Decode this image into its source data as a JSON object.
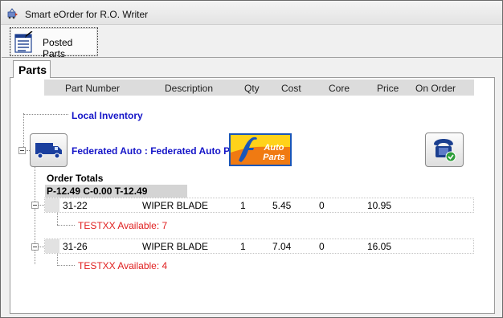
{
  "window": {
    "title": "Smart eOrder for R.O. Writer"
  },
  "toolbar": {
    "posted_parts_label": "Posted Parts"
  },
  "tabs": {
    "parts_label": "Parts"
  },
  "columns": [
    "Part Number",
    "Description",
    "Qty",
    "Cost",
    "Core",
    "Price",
    "On Order"
  ],
  "tree": {
    "local_inventory": "Local Inventory",
    "supplier_label": "Federated Auto : Federated Auto P...",
    "supplier_logo_text": [
      "Auto",
      "Parts"
    ],
    "order_totals_title": "Order Totals",
    "order_totals_value": "P-12.49 C-0.00 T-12.49"
  },
  "items": [
    {
      "part_number": "31-22",
      "description": "WIPER BLADE",
      "qty": "1",
      "cost": "5.45",
      "core": "0",
      "price": "10.95",
      "on_order": "",
      "availability": "TESTXX Available: 7"
    },
    {
      "part_number": "31-26",
      "description": "WIPER BLADE",
      "qty": "1",
      "cost": "7.04",
      "core": "0",
      "price": "16.05",
      "on_order": "",
      "availability": "TESTXX Available: 4"
    }
  ],
  "colors": {
    "link_blue": "#1515c8",
    "avail_red": "#e01e1e",
    "logo_orange": "#f07a12",
    "logo_yellow": "#ffd21a",
    "truck_blue": "#1b3f9e"
  },
  "icons": [
    "app-icon",
    "posted-parts-icon",
    "truck-icon",
    "phone-check-icon"
  ]
}
